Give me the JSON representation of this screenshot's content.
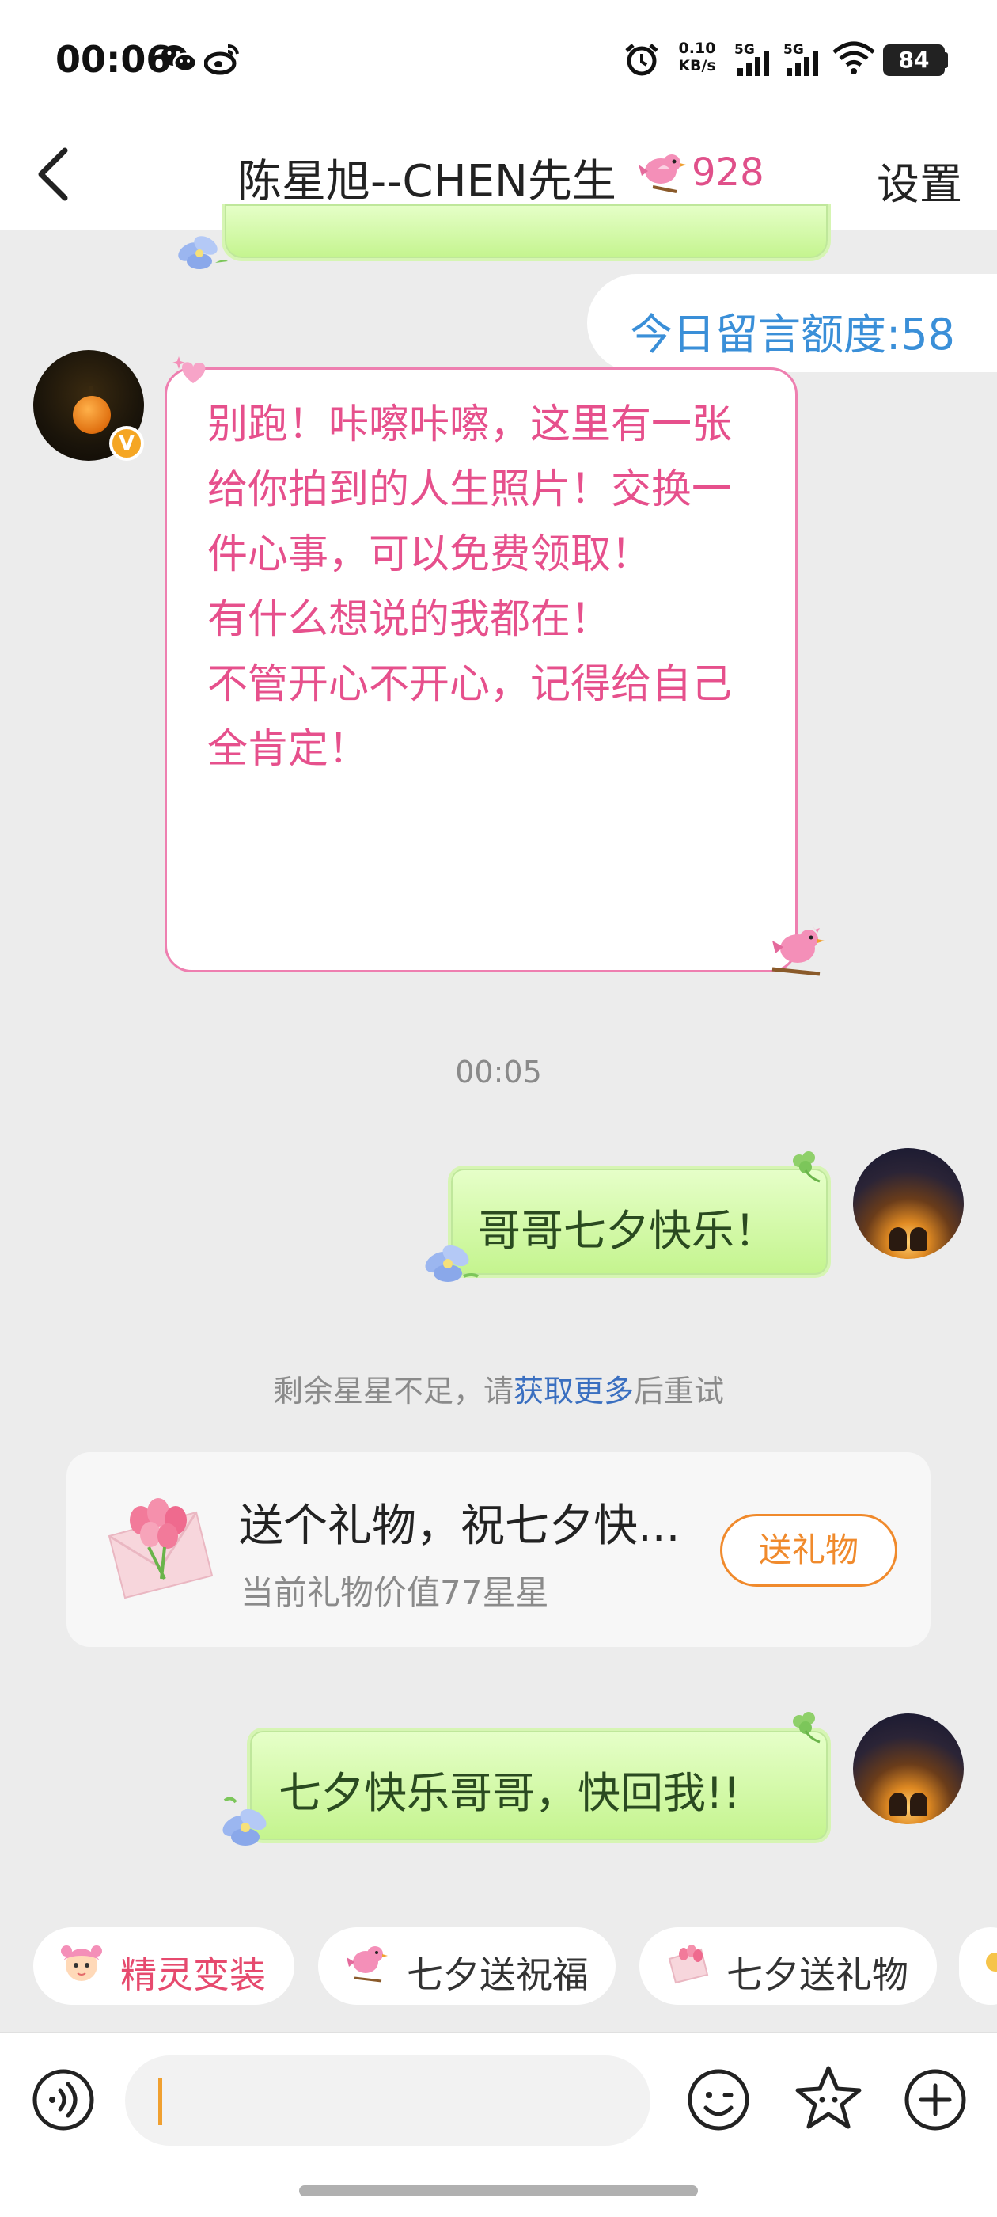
{
  "status_bar": {
    "time": "00:06",
    "net_speed_value": "0.10",
    "net_speed_unit": "KB/s",
    "signal1_label": "5G",
    "signal2_label": "5G",
    "battery": "84"
  },
  "nav": {
    "title": "陈星旭--CHEN先生",
    "title_number": "928",
    "settings_label": "设置"
  },
  "chat": {
    "quota": "今日留言额度:58",
    "bot_message": "别跑！咔嚓咔嚓，这里有一张给你拍到的人生照片！交换一件心事，可以免费领取！\n有什么想说的我都在！\n不管开心不开心，记得给自己全肯定！",
    "timestamp": "00:05",
    "user_message_1": "哥哥七夕快乐！",
    "notice_prefix": "剩余星星不足，请",
    "notice_link": "获取更多",
    "notice_suffix": "后重试",
    "gift_title": "送个礼物，祝七夕快...",
    "gift_subtitle": "当前礼物价值77星星",
    "gift_button": "送礼物",
    "user_message_2": "七夕快乐哥哥，快回我!!"
  },
  "quick_actions": [
    {
      "label": "精灵变装",
      "icon": "sprite-costume-icon"
    },
    {
      "label": "七夕送祝福",
      "icon": "pink-bird-icon"
    },
    {
      "label": "七夕送礼物",
      "icon": "gift-envelope-icon"
    }
  ],
  "input": {
    "value": ""
  },
  "colors": {
    "bot_text": "#e6508c",
    "link": "#3a6fc0",
    "accent_orange": "#f08a2c",
    "quota_blue": "#3a8fd8",
    "bubble_green": "#c4f48e"
  }
}
